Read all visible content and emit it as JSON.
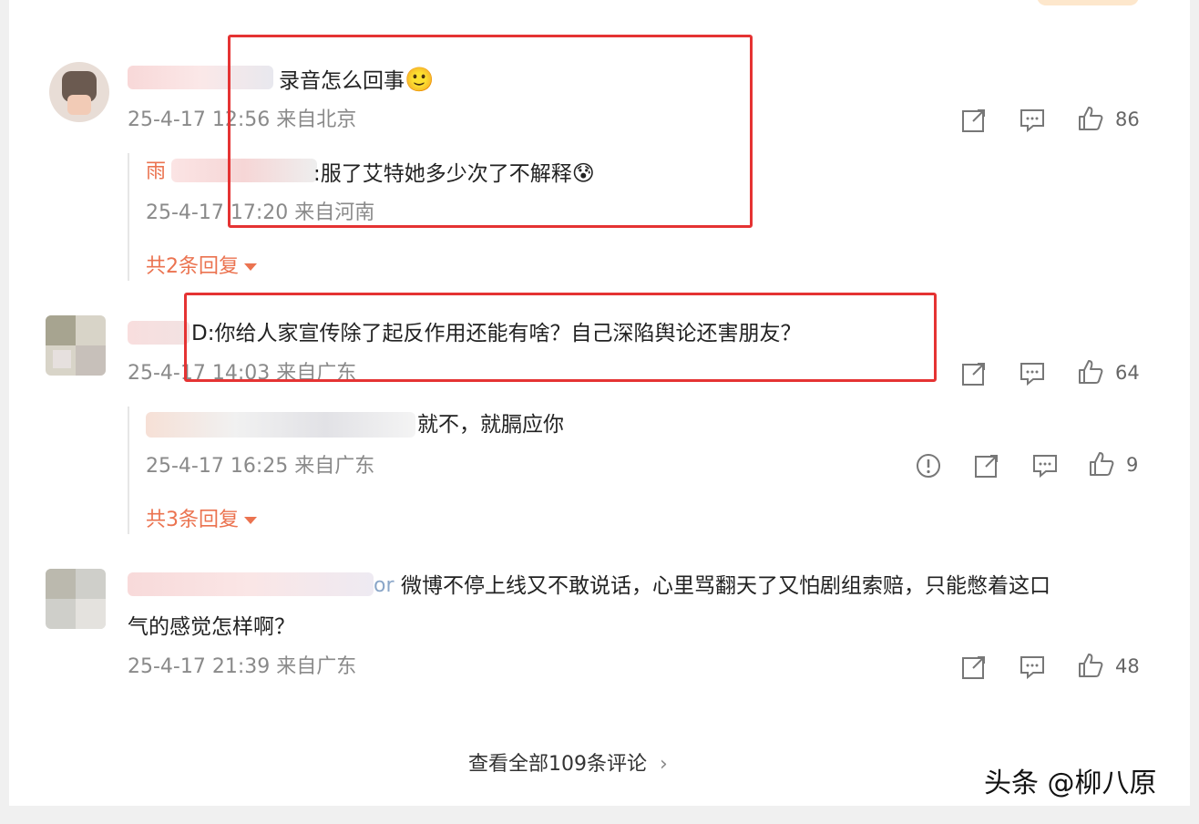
{
  "comments": [
    {
      "text": "录音怎么回事",
      "emoji": "🙂",
      "meta": "25-4-17 12:56 来自北京",
      "likes": "86",
      "reply": {
        "name": "雨",
        "text": ":服了艾特她多少次了不解释",
        "emoji": "😰",
        "meta": "25-4-17 17:20 来自河南"
      },
      "more_replies": "共2条回复"
    },
    {
      "text": "D:你给人家宣传除了起反作用还能有啥？自己深陷舆论还害朋友？",
      "meta": "25-4-17 14:03 来自广东",
      "likes": "64",
      "reply": {
        "text": "就不，就膈应你",
        "meta": "25-4-17 16:25 来自广东",
        "likes": "9"
      },
      "more_replies": "共3条回复"
    },
    {
      "name_tail": "or",
      "text_line1": "微博不停上线又不敢说话，心里骂翻天了又怕剧组索赔，只能憋着这口",
      "text_line2": "气的感觉怎样啊？",
      "meta": "25-4-17 21:39 来自广东",
      "likes": "48"
    }
  ],
  "view_all": "查看全部109条评论",
  "watermark": "头条 @柳八原",
  "colors": {
    "name": "#eb7350",
    "highlight": "#e53333",
    "meta": "#8a8a8a"
  }
}
